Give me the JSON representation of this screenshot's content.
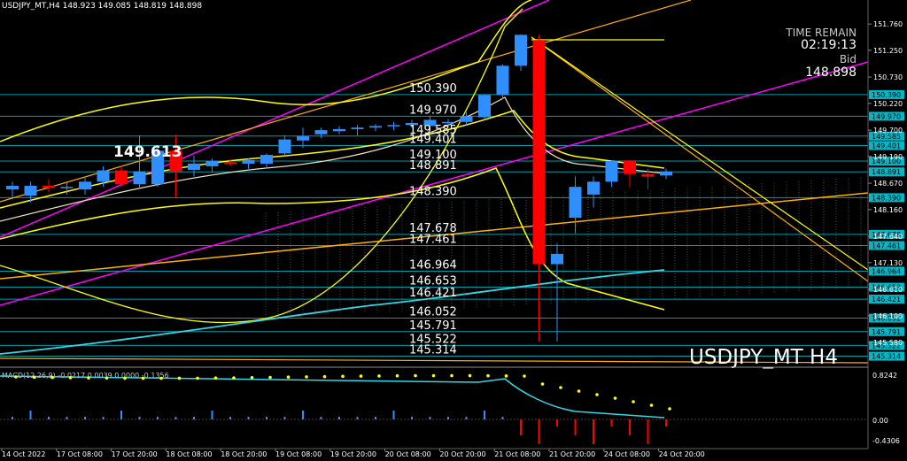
{
  "header": {
    "title": "USDJPY_MT,H4  148.923 149.085 148.819 148.898"
  },
  "watermark": "USDJPY_MT H4",
  "countdown": {
    "label": "TIME REMAIN",
    "value": "02:19:13",
    "bid_label": "Bid",
    "bid_value": "148.898"
  },
  "colors": {
    "bull": "#2f8fff",
    "bear": "#ff0000",
    "level": "#00b8c8",
    "yellow": "#ffff00",
    "magenta": "#ff00ff",
    "orange": "#ffb000",
    "cyan": "#30d8e8"
  },
  "chart_data": {
    "type": "candlestick",
    "symbol": "USDJPY_MT",
    "timeframe": "H4",
    "ylim": [
      145.1,
      152.02
    ],
    "y_ticks": [
      "151.760",
      "151.250",
      "150.730",
      "150.220",
      "149.700",
      "149.190",
      "148.670",
      "148.160",
      "147.640",
      "147.130",
      "146.610",
      "146.100",
      "145.580"
    ],
    "x_ticks": [
      "14 Oct 2022",
      "17 Oct 08:00",
      "17 Oct 20:00",
      "18 Oct 08:00",
      "18 Oct 20:00",
      "19 Oct 08:00",
      "19 Oct 20:00",
      "20 Oct 08:00",
      "20 Oct 20:00",
      "21 Oct 08:00",
      "21 Oct 20:00",
      "24 Oct 08:00",
      "24 Oct 20:00"
    ],
    "candles": [
      {
        "o": 148.55,
        "h": 148.7,
        "l": 148.4,
        "c": 148.62
      },
      {
        "o": 148.43,
        "h": 148.7,
        "l": 148.3,
        "c": 148.62
      },
      {
        "o": 148.62,
        "h": 148.75,
        "l": 148.5,
        "c": 148.58
      },
      {
        "o": 148.58,
        "h": 148.68,
        "l": 148.45,
        "c": 148.6
      },
      {
        "o": 148.55,
        "h": 148.8,
        "l": 148.45,
        "c": 148.7
      },
      {
        "o": 148.7,
        "h": 149.0,
        "l": 148.6,
        "c": 148.92
      },
      {
        "o": 148.92,
        "h": 149.0,
        "l": 148.6,
        "c": 148.65
      },
      {
        "o": 148.65,
        "h": 149.6,
        "l": 148.55,
        "c": 148.9
      },
      {
        "o": 148.65,
        "h": 149.4,
        "l": 148.6,
        "c": 149.3
      },
      {
        "o": 149.3,
        "h": 149.61,
        "l": 148.4,
        "c": 148.9
      },
      {
        "o": 148.93,
        "h": 149.2,
        "l": 148.8,
        "c": 149.05
      },
      {
        "o": 149.0,
        "h": 149.15,
        "l": 148.88,
        "c": 149.1
      },
      {
        "o": 149.08,
        "h": 149.14,
        "l": 149.0,
        "c": 149.05
      },
      {
        "o": 149.05,
        "h": 149.15,
        "l": 148.95,
        "c": 149.12
      },
      {
        "o": 149.05,
        "h": 149.25,
        "l": 148.95,
        "c": 149.22
      },
      {
        "o": 149.25,
        "h": 149.6,
        "l": 149.2,
        "c": 149.52
      },
      {
        "o": 149.5,
        "h": 149.75,
        "l": 149.35,
        "c": 149.58
      },
      {
        "o": 149.62,
        "h": 149.75,
        "l": 149.55,
        "c": 149.7
      },
      {
        "o": 149.68,
        "h": 149.78,
        "l": 149.62,
        "c": 149.72
      },
      {
        "o": 149.72,
        "h": 149.8,
        "l": 149.6,
        "c": 149.75
      },
      {
        "o": 149.75,
        "h": 149.82,
        "l": 149.68,
        "c": 149.78
      },
      {
        "o": 149.78,
        "h": 149.86,
        "l": 149.7,
        "c": 149.8
      },
      {
        "o": 149.8,
        "h": 149.9,
        "l": 149.74,
        "c": 149.84
      },
      {
        "o": 149.78,
        "h": 149.98,
        "l": 149.7,
        "c": 149.9
      },
      {
        "o": 149.84,
        "h": 149.92,
        "l": 149.78,
        "c": 149.86
      },
      {
        "o": 149.86,
        "h": 150.05,
        "l": 149.8,
        "c": 149.97
      },
      {
        "o": 149.95,
        "h": 150.4,
        "l": 149.9,
        "c": 150.38
      },
      {
        "o": 150.38,
        "h": 150.98,
        "l": 150.3,
        "c": 150.95
      },
      {
        "o": 150.95,
        "h": 151.56,
        "l": 150.85,
        "c": 151.55
      },
      {
        "o": 151.45,
        "h": 151.55,
        "l": 145.6,
        "c": 147.1
      },
      {
        "o": 147.1,
        "h": 147.5,
        "l": 145.6,
        "c": 147.3
      },
      {
        "o": 148.0,
        "h": 148.8,
        "l": 147.7,
        "c": 148.6
      },
      {
        "o": 148.45,
        "h": 148.8,
        "l": 148.2,
        "c": 148.7
      },
      {
        "o": 148.7,
        "h": 149.12,
        "l": 148.6,
        "c": 149.1
      },
      {
        "o": 149.1,
        "h": 149.12,
        "l": 148.6,
        "c": 148.85
      },
      {
        "o": 148.85,
        "h": 148.95,
        "l": 148.55,
        "c": 148.8
      },
      {
        "o": 148.82,
        "h": 148.95,
        "l": 148.75,
        "c": 148.9
      }
    ],
    "levels": [
      {
        "label": "150.390",
        "value": 150.39
      },
      {
        "label": "149.970",
        "value": 149.97
      },
      {
        "label": "149.585",
        "value": 149.585
      },
      {
        "label": "149.401",
        "value": 149.401
      },
      {
        "label": "149.100",
        "value": 149.1
      },
      {
        "label": "148.891",
        "value": 148.891
      },
      {
        "label": "148.390",
        "value": 148.39
      },
      {
        "label": "147.678",
        "value": 147.678
      },
      {
        "label": "147.461",
        "value": 147.461
      },
      {
        "label": "146.964",
        "value": 146.964
      },
      {
        "label": "146.653",
        "value": 146.653
      },
      {
        "label": "146.421",
        "value": 146.421
      },
      {
        "label": "146.052",
        "value": 146.052
      },
      {
        "label": "145.791",
        "value": 145.791
      },
      {
        "label": "145.522",
        "value": 145.522
      },
      {
        "label": "145.314",
        "value": 145.314
      }
    ],
    "annotation": "149.613",
    "macd": {
      "label": "MACD(12,26,9) -0.0217 0.0039 0.0000 -0.1356",
      "y_ticks": [
        "0.8242",
        "0.00",
        "-0.4306"
      ]
    }
  }
}
